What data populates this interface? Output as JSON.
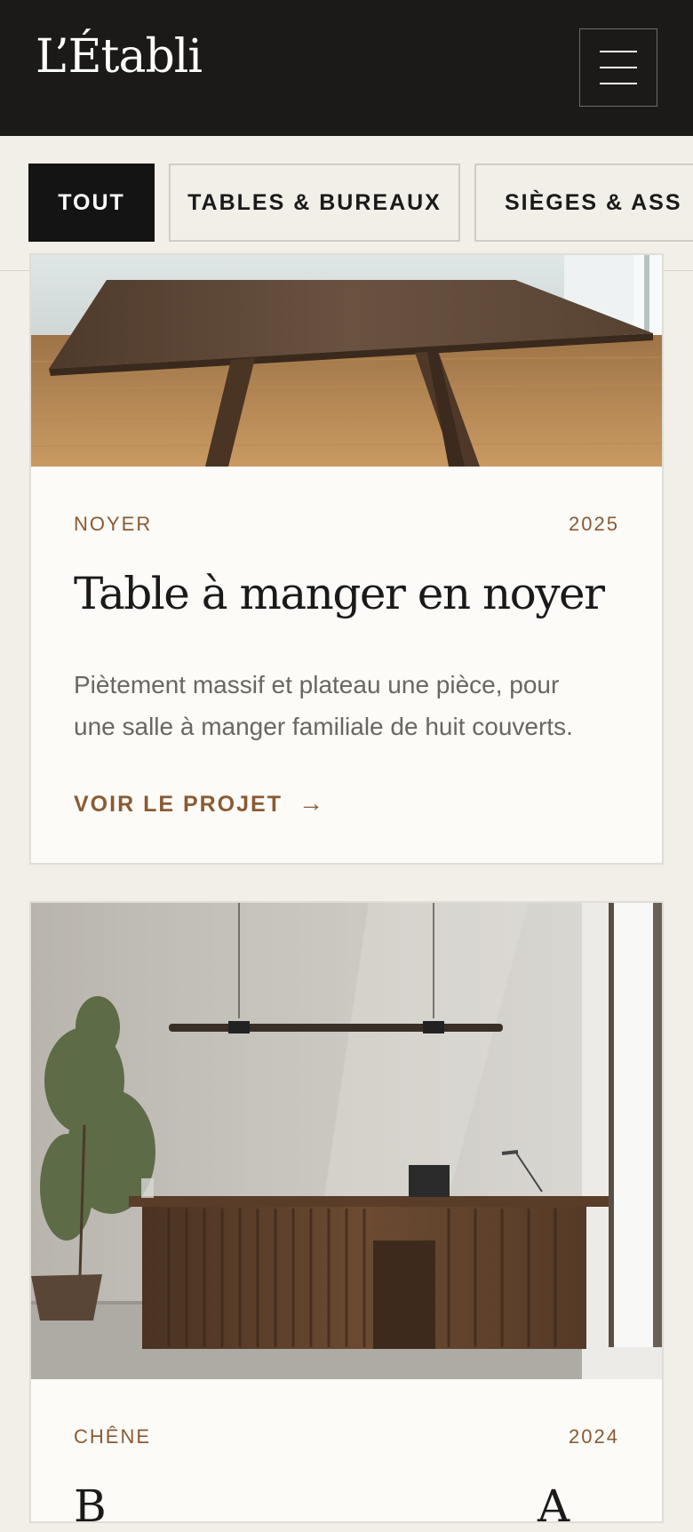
{
  "header": {
    "logo": "L’Établi",
    "menu_icon": "hamburger-menu-icon"
  },
  "filters": [
    {
      "label": "TOUT",
      "active": true
    },
    {
      "label": "TABLES & BUREAUX",
      "active": false
    },
    {
      "label": "SIÈGES & ASS",
      "active": false
    }
  ],
  "projects": [
    {
      "material": "NOYER",
      "year": "2025",
      "title": "Table à manger en noyer",
      "description": "Piètement massif et plateau une pièce, pour une salle à manger familiale de huit couverts.",
      "link_label": "VOIR LE PROJET",
      "link_icon": "arrow-right-icon"
    },
    {
      "material": "CHÊNE",
      "year": "2024",
      "title": "B",
      "title_tail": "A"
    }
  ],
  "colors": {
    "header_bg": "#1b1a18",
    "page_bg": "#f2efe8",
    "accent": "#8a5a33",
    "card_bg": "#fcfbf8"
  }
}
